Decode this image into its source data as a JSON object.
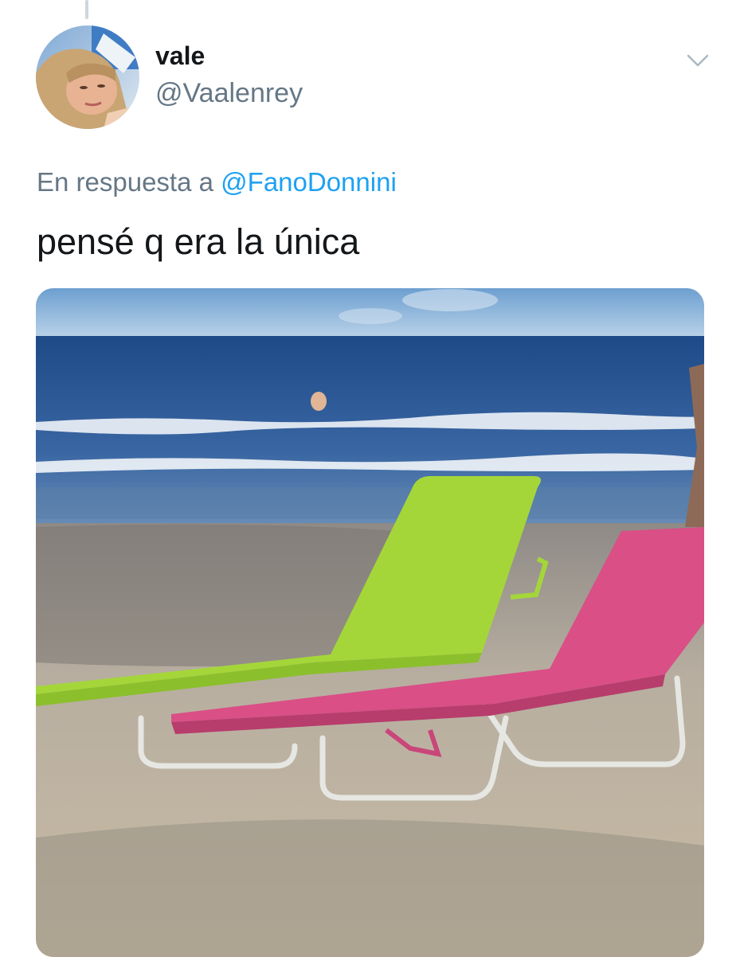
{
  "tweet": {
    "display_name": "vale",
    "handle": "@Vaalenrey",
    "reply_prefix": "En respuesta a",
    "reply_to": "@FanoDonnini",
    "text": "pensé q era la única"
  },
  "icons": {
    "menu": "chevron-down-icon"
  },
  "colors": {
    "primary_text": "#14171a",
    "secondary_text": "#657786",
    "link": "#1da1f2",
    "lounger_green": "#a4d63a",
    "lounger_pink": "#d94f86"
  }
}
